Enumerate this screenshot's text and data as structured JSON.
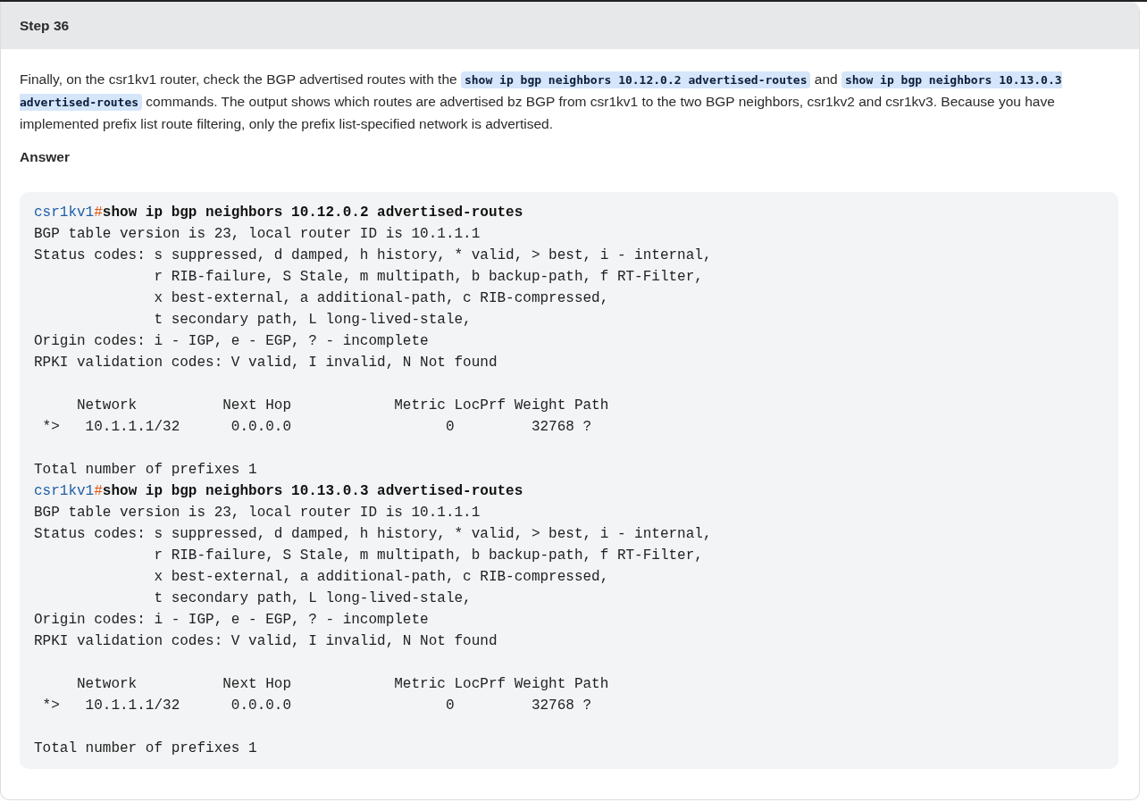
{
  "step": {
    "title": "Step 36"
  },
  "paragraph": [
    {
      "kind": "text",
      "text": "Finally, on the csr1kv1 router, check the BGP advertised routes with the "
    },
    {
      "kind": "code",
      "text": "show ip bgp neighbors 10.12.0.2 advertised-routes"
    },
    {
      "kind": "text",
      "text": " and "
    },
    {
      "kind": "code",
      "text": "show ip bgp neighbors 10.13.0.3 advertised-routes"
    },
    {
      "kind": "text",
      "text": " commands. The output shows which routes are advertised bz BGP from csr1kv1 to the two BGP neighbors, csr1kv2 and csr1kv3. Because you have implemented prefix list route filtering, only the prefix list-specified network is advertised."
    }
  ],
  "answer_heading": "Answer",
  "code_lines": [
    {
      "kind": "command",
      "prompt": "csr1kv1",
      "symbol": "#",
      "command": "show ip bgp neighbors 10.12.0.2 advertised-routes"
    },
    {
      "kind": "output",
      "text": "BGP table version is 23, local router ID is 10.1.1.1"
    },
    {
      "kind": "output",
      "text": "Status codes: s suppressed, d damped, h history, * valid, > best, i - internal,"
    },
    {
      "kind": "output",
      "text": "              r RIB-failure, S Stale, m multipath, b backup-path, f RT-Filter,"
    },
    {
      "kind": "output",
      "text": "              x best-external, a additional-path, c RIB-compressed,"
    },
    {
      "kind": "output",
      "text": "              t secondary path, L long-lived-stale,"
    },
    {
      "kind": "output",
      "text": "Origin codes: i - IGP, e - EGP, ? - incomplete"
    },
    {
      "kind": "output",
      "text": "RPKI validation codes: V valid, I invalid, N Not found"
    },
    {
      "kind": "blank"
    },
    {
      "kind": "output",
      "text": "     Network          Next Hop            Metric LocPrf Weight Path"
    },
    {
      "kind": "output",
      "text": " *>   10.1.1.1/32      0.0.0.0                  0         32768 ?"
    },
    {
      "kind": "blank"
    },
    {
      "kind": "output",
      "text": "Total number of prefixes 1"
    },
    {
      "kind": "command",
      "prompt": "csr1kv1",
      "symbol": "#",
      "command": "show ip bgp neighbors 10.13.0.3 advertised-routes"
    },
    {
      "kind": "output",
      "text": "BGP table version is 23, local router ID is 10.1.1.1"
    },
    {
      "kind": "output",
      "text": "Status codes: s suppressed, d damped, h history, * valid, > best, i - internal,"
    },
    {
      "kind": "output",
      "text": "              r RIB-failure, S Stale, m multipath, b backup-path, f RT-Filter,"
    },
    {
      "kind": "output",
      "text": "              x best-external, a additional-path, c RIB-compressed,"
    },
    {
      "kind": "output",
      "text": "              t secondary path, L long-lived-stale,"
    },
    {
      "kind": "output",
      "text": "Origin codes: i - IGP, e - EGP, ? - incomplete"
    },
    {
      "kind": "output",
      "text": "RPKI validation codes: V valid, I invalid, N Not found"
    },
    {
      "kind": "blank"
    },
    {
      "kind": "output",
      "text": "     Network          Next Hop            Metric LocPrf Weight Path"
    },
    {
      "kind": "output",
      "text": " *>   10.1.1.1/32      0.0.0.0                  0         32768 ?"
    },
    {
      "kind": "blank"
    },
    {
      "kind": "output",
      "text": "Total number of prefixes 1"
    }
  ]
}
